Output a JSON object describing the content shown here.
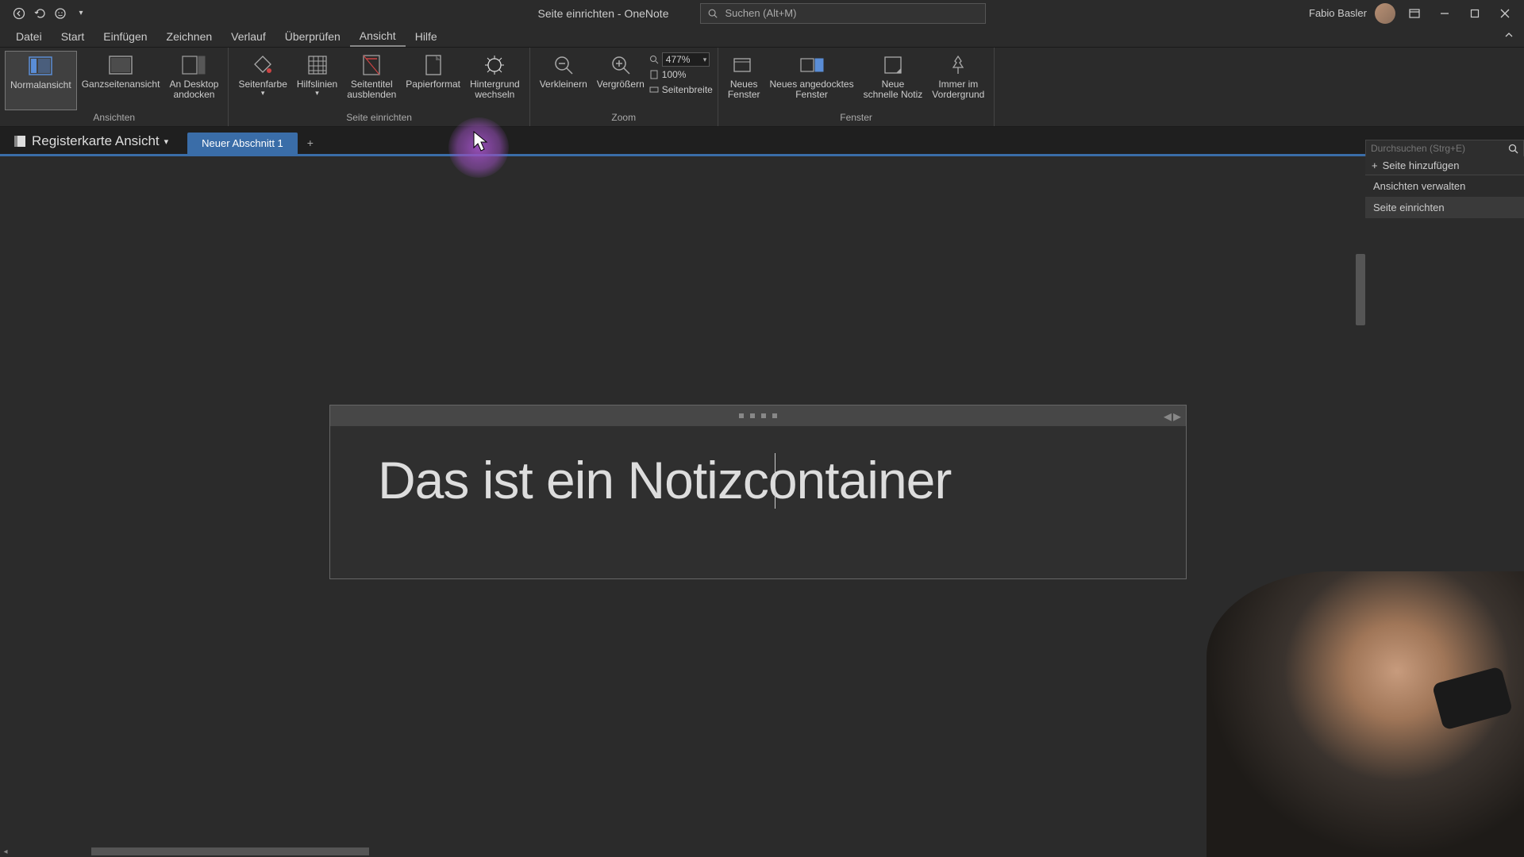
{
  "titlebar": {
    "title": "Seite einrichten  -  OneNote",
    "search_placeholder": "Suchen (Alt+M)",
    "user_name": "Fabio Basler"
  },
  "menu": {
    "tabs": [
      "Datei",
      "Start",
      "Einfügen",
      "Zeichnen",
      "Verlauf",
      "Überprüfen",
      "Ansicht",
      "Hilfe"
    ],
    "active": "Ansicht"
  },
  "ribbon": {
    "groups": {
      "views": {
        "title": "Ansichten",
        "buttons": {
          "normal": "Normalansicht",
          "fullpage": "Ganzseitenansicht",
          "dock": "An Desktop\nandocken"
        }
      },
      "page_setup": {
        "title": "Seite einrichten",
        "buttons": {
          "page_color": "Seitenfarbe",
          "rule_lines": "Hilfslinien",
          "hide_title": "Seitentitel\nausblenden",
          "paper_size": "Papierformat",
          "background": "Hintergrund\nwechseln"
        }
      },
      "zoom": {
        "title": "Zoom",
        "zoom_out": "Verkleinern",
        "zoom_in": "Vergrößern",
        "zoom_value": "477%",
        "zoom_100": "100%",
        "page_width": "Seitenbreite"
      },
      "window": {
        "title": "Fenster",
        "new_window": "Neues\nFenster",
        "new_docked": "Neues angedocktes\nFenster",
        "quick_note": "Neue\nschnelle Notiz",
        "always_top": "Immer im\nVordergrund"
      }
    }
  },
  "navbar": {
    "notebook_label": "Registerkarte Ansicht",
    "section_tab": "Neuer Abschnitt 1"
  },
  "rightpanel": {
    "search_placeholder": "Durchsuchen (Strg+E)",
    "add_page": "Seite hinzufügen",
    "pages": [
      "Ansichten verwalten",
      "Seite einrichten"
    ]
  },
  "note": {
    "text": "Das ist ein Notizcontainer"
  }
}
